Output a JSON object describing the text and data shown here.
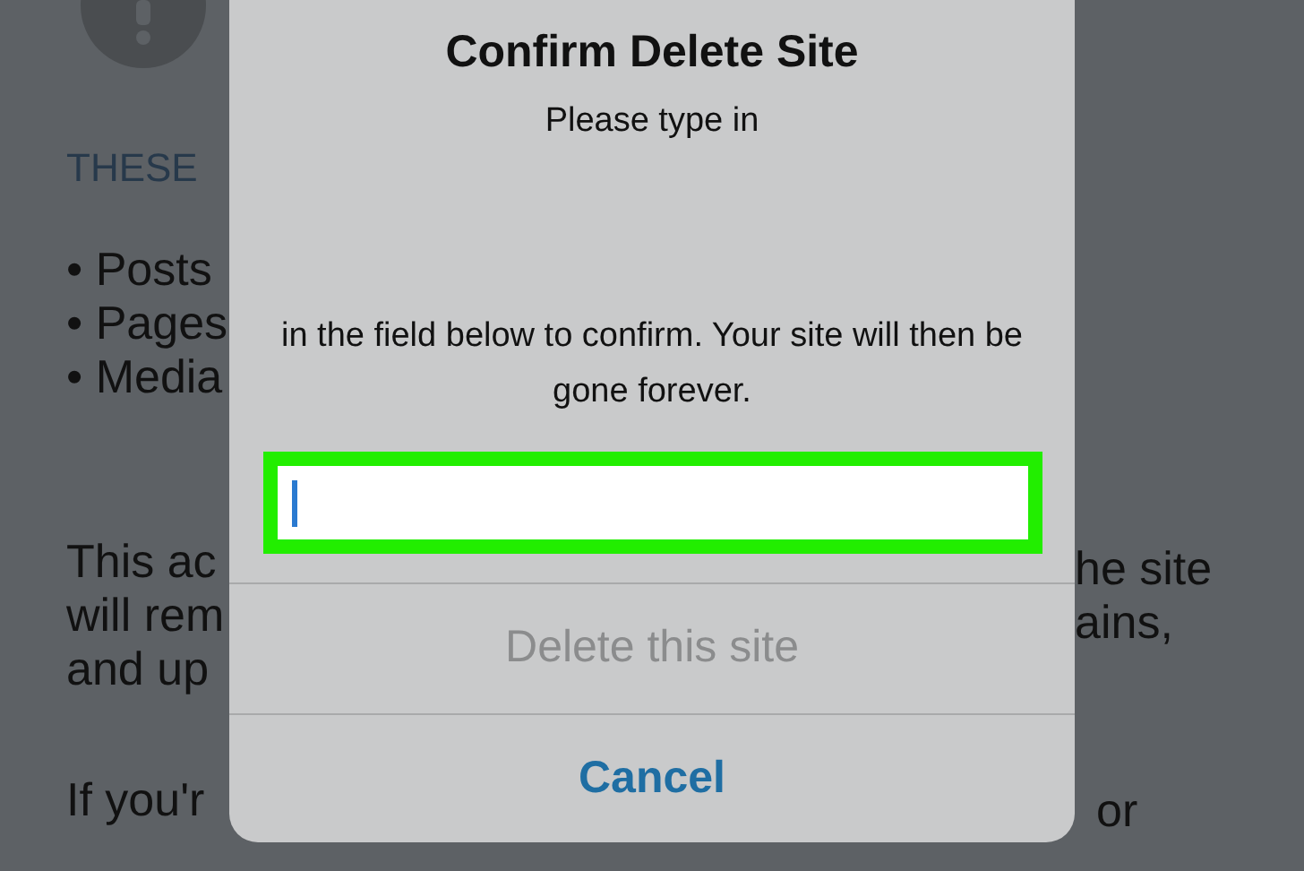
{
  "background": {
    "left_column": {
      "heading": "THESE",
      "bullets": [
        "• Posts",
        "• Pages",
        "• Media"
      ],
      "paragraph_1": [
        "This ac",
        "will rem",
        "and up"
      ],
      "paragraph_2": [
        "If you'r"
      ]
    },
    "right_column": {
      "paragraph_1": [
        "he site",
        "ains,"
      ],
      "paragraph_2": [
        "or"
      ]
    }
  },
  "dialog": {
    "title": "Confirm Delete Site",
    "message_before": "Please type in",
    "message_after": "in the field below to confirm. Your site will then be gone forever.",
    "field": {
      "focused": true,
      "highlighted": true
    },
    "actions": [
      {
        "label": "Delete this site",
        "disabled": true,
        "bold": false
      },
      {
        "label": "Cancel",
        "disabled": false,
        "bold": true
      }
    ]
  }
}
